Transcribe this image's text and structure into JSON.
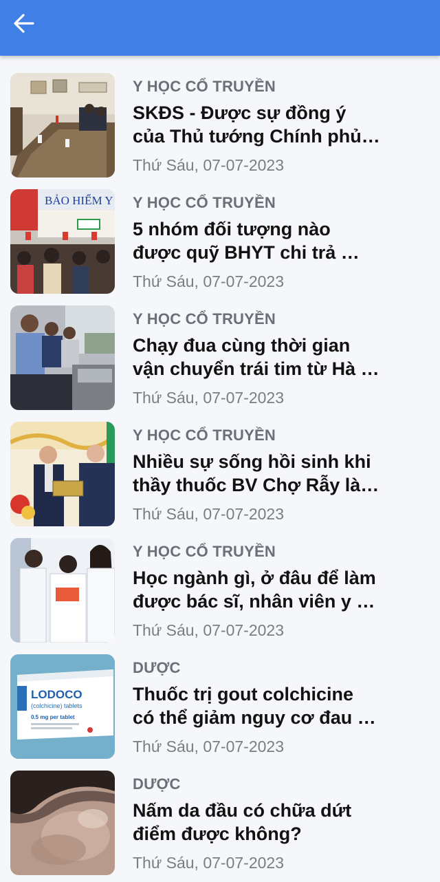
{
  "header": {
    "back_icon": "arrow-left-icon",
    "color": "#3f7fe6"
  },
  "articles": [
    {
      "category": "Y HỌC CỔ TRUYỀN",
      "title": "SKĐS - Được sự đồng ý của Thủ tướng Chính phủ …",
      "date": "Thứ Sáu, 07-07-2023"
    },
    {
      "category": "Y HỌC CỔ TRUYỀN",
      "title": "5 nhóm đối tượng nào được quỹ BHYT chi trả …",
      "date": "Thứ Sáu, 07-07-2023",
      "image_text": "BẢO HIỂM Y"
    },
    {
      "category": "Y HỌC CỔ TRUYỀN",
      "title": "Chạy đua cùng thời gian vận chuyển trái tim từ Hà …",
      "date": "Thứ Sáu, 07-07-2023"
    },
    {
      "category": "Y HỌC CỔ TRUYỀN",
      "title": "Nhiều sự sống hồi sinh khi thầy thuốc BV Chợ Rẫy là…",
      "date": "Thứ Sáu, 07-07-2023"
    },
    {
      "category": "Y HỌC CỔ TRUYỀN",
      "title": "Học ngành gì, ở đâu để làm được bác sĩ, nhân viên y …",
      "date": "Thứ Sáu, 07-07-2023"
    },
    {
      "category": "DƯỢC",
      "title": "Thuốc trị gout colchicine có thể giảm nguy cơ đau …",
      "date": "Thứ Sáu, 07-07-2023",
      "image_text": [
        "LODOCO",
        "(colchicine) tablets",
        "0.5 mg per tablet"
      ]
    },
    {
      "category": "DƯỢC",
      "title": "Nấm da đầu có chữa dứt điểm được không?",
      "date": "Thứ Sáu, 07-07-2023"
    }
  ]
}
